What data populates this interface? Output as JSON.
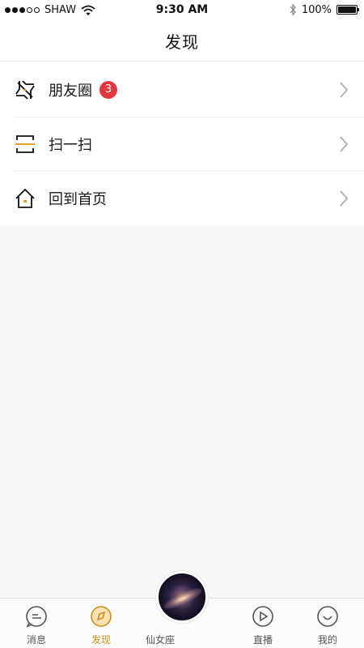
{
  "status_bar": {
    "carrier": "SHAW",
    "time": "9:30 AM",
    "battery": "100%"
  },
  "header": {
    "title": "发现"
  },
  "list": {
    "items": [
      {
        "label": "朋友圈",
        "badge": "3",
        "icon": "moments-icon"
      },
      {
        "label": "扫一扫",
        "icon": "scan-icon"
      },
      {
        "label": "回到首页",
        "icon": "home-icon"
      }
    ]
  },
  "tabbar": {
    "tabs": [
      {
        "label": "消息",
        "icon": "message-icon",
        "active": false
      },
      {
        "label": "发现",
        "icon": "compass-icon",
        "active": true
      },
      {
        "label": "仙女座",
        "icon": "galaxy-image",
        "active": false
      },
      {
        "label": "直播",
        "icon": "play-icon",
        "active": false
      },
      {
        "label": "我的",
        "icon": "profile-icon",
        "active": false
      }
    ]
  },
  "colors": {
    "accent": "#c8901e",
    "badge": "#e2373f",
    "scan_line": "#e4a12a"
  }
}
